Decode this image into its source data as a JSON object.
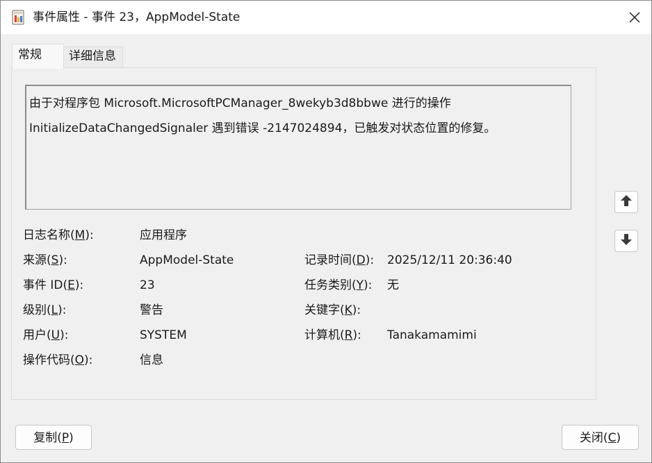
{
  "window": {
    "title": "事件属性 - 事件 23，AppModel-State"
  },
  "tabs": [
    {
      "label": "常规",
      "active": true
    },
    {
      "label": "详细信息",
      "active": false
    }
  ],
  "description": "由于对程序包 Microsoft.MicrosoftPCManager_8wekyb3d8bbwe 进行的操作\nInitializeDataChangedSignaler 遇到错误 -2147024894，已触发对状态位置的修复。",
  "fields": {
    "log_name": {
      "label_pre": "日志名称(",
      "key": "M",
      "label_post": "):",
      "value": "应用程序"
    },
    "source": {
      "label_pre": "来源(",
      "key": "S",
      "label_post": "):",
      "value": "AppModel-State"
    },
    "event_id": {
      "label_pre": "事件 ID(",
      "key": "E",
      "label_post": "):",
      "value": "23"
    },
    "level": {
      "label_pre": "级别(",
      "key": "L",
      "label_post": "):",
      "value": "警告"
    },
    "user": {
      "label_pre": "用户(",
      "key": "U",
      "label_post": "):",
      "value": "SYSTEM"
    },
    "opcode": {
      "label_pre": "操作代码(",
      "key": "O",
      "label_post": "):",
      "value": "信息"
    },
    "logged": {
      "label_pre": "记录时间(",
      "key": "D",
      "label_post": "):",
      "value": "2025/12/11 20:36:40"
    },
    "task_category": {
      "label_pre": "任务类别(",
      "key": "Y",
      "label_post": "):",
      "value": "无"
    },
    "keywords": {
      "label_pre": "关键字(",
      "key": "K",
      "label_post": "):",
      "value": ""
    },
    "computer": {
      "label_pre": "计算机(",
      "key": "R",
      "label_post": "):",
      "value": "Tanakamamimi"
    }
  },
  "buttons": {
    "copy": {
      "pre": "复制(",
      "key": "P",
      "post": ")"
    },
    "close": {
      "pre": "关闭(",
      "key": "C",
      "post": ")"
    }
  },
  "icons": {
    "app": "event-log-icon",
    "close": "close-icon",
    "up": "arrow-up-icon",
    "down": "arrow-down-icon"
  },
  "colors": {
    "titlebar": "#ffffff",
    "background": "#f0f0f0",
    "arrow": "#3a3a3a"
  }
}
